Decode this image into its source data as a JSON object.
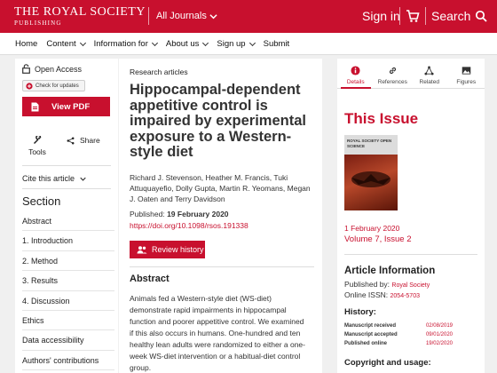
{
  "header": {
    "logo_line1": "THE ROYAL SOCIETY",
    "logo_line2": "PUBLISHING",
    "journals_label": "All Journals",
    "signin_label": "Sign in",
    "search_label": "Search",
    "brand_color": "#c8102e"
  },
  "nav": {
    "items": [
      {
        "label": "Home",
        "has_menu": false
      },
      {
        "label": "Content",
        "has_menu": true
      },
      {
        "label": "Information for",
        "has_menu": true
      },
      {
        "label": "About us",
        "has_menu": true
      },
      {
        "label": "Sign up",
        "has_menu": true
      },
      {
        "label": "Submit",
        "has_menu": false
      }
    ]
  },
  "left": {
    "open_access": "Open Access",
    "check_updates": "Check for updates",
    "view_pdf": "View PDF",
    "tools": "Tools",
    "share": "Share",
    "cite": "Cite this article",
    "section_heading": "Section",
    "sections": [
      "Abstract",
      "1. Introduction",
      "2. Method",
      "3. Results",
      "4. Discussion",
      "Ethics",
      "Data accessibility",
      "Authors' contributions"
    ]
  },
  "article": {
    "type_label": "Research articles",
    "title": "Hippocampal-dependent appetitive control is impaired by experimental exposure to a Western-style diet",
    "authors": "Richard J. Stevenson, Heather M. Francis, Tuki Attuquayefio, Dolly Gupta, Martin R. Yeomans, Megan J. Oaten and Terry Davidson",
    "published_label": "Published:",
    "published_date": "19 February 2020",
    "doi": "https://doi.org/10.1098/rsos.191338",
    "review_history": "Review history",
    "abstract_heading": "Abstract",
    "abstract_text": "Animals fed a Western-style diet (WS-diet) demonstrate rapid impairments in hippocampal function and poorer appetitive control. We examined if this also occurs in humans. One-hundred and ten healthy lean adults were randomized to either a one-week WS-diet intervention or a habitual-diet control group."
  },
  "sidebar": {
    "tabs": [
      {
        "label": "Details",
        "icon": "info-icon",
        "active": true
      },
      {
        "label": "References",
        "icon": "link-icon",
        "active": false
      },
      {
        "label": "Related",
        "icon": "network-icon",
        "active": false
      },
      {
        "label": "Figures",
        "icon": "image-icon",
        "active": false
      }
    ],
    "this_issue": "This Issue",
    "cover_title": "ROYAL SOCIETY OPEN SCIENCE",
    "issue_date": "1 February 2020",
    "volume": "Volume 7, Issue 2",
    "article_info": "Article Information",
    "published_by_label": "Published by:",
    "publisher": "Royal Society",
    "issn_label": "Online ISSN:",
    "issn": "2054-5703",
    "history_heading": "History:",
    "history": [
      {
        "label": "Manuscript received",
        "date": "02/08/2019"
      },
      {
        "label": "Manuscript accepted",
        "date": "09/01/2020"
      },
      {
        "label": "Published online",
        "date": "19/02/2020"
      }
    ],
    "copyright_heading": "Copyright and usage:"
  }
}
